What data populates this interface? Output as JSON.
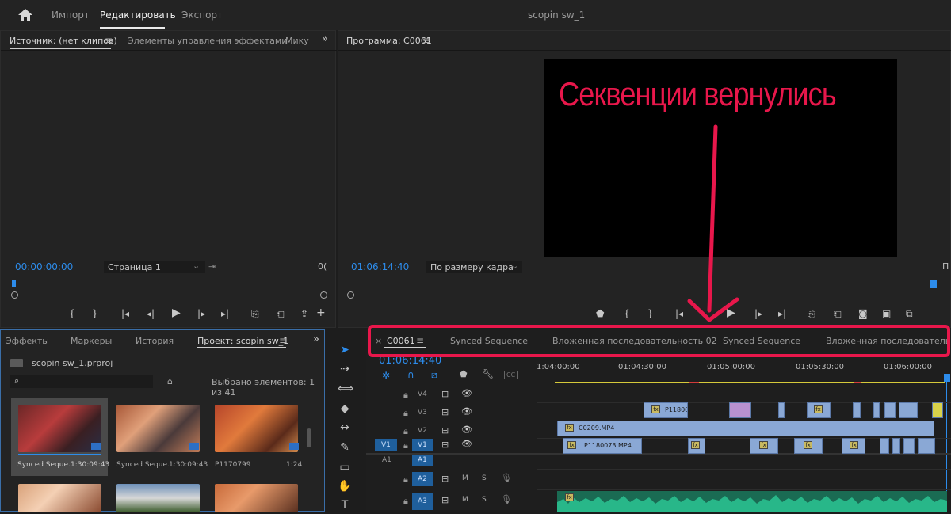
{
  "topbar": {
    "workspaces": [
      "Импорт",
      "Редактировать",
      "Экспорт"
    ],
    "title": "scopin sw_1"
  },
  "source_panel": {
    "tabs": [
      "Источник: (нет клипов)",
      "Элементы управления эффектами",
      "Мику"
    ],
    "timecode": "00:00:00:00",
    "page_select": "Страница 1",
    "right_tc": "0("
  },
  "program_panel": {
    "tab": "Программа: C0061",
    "timecode": "01:06:14:40",
    "fit_select": "По размеру кадра",
    "right_stub": "П",
    "overlay_caption": "Секвенции вернулись"
  },
  "project_panel": {
    "tabs": [
      "Эффекты",
      "Маркеры",
      "История",
      "Проект: scopin sw_1"
    ],
    "project_file": "scopin sw_1.prproj",
    "selection": "Выбрано элементов: 1 из 41",
    "search_placeholder": "",
    "items": [
      {
        "name": "Synced Seque...",
        "duration": "1:30:09:43"
      },
      {
        "name": "Synced Seque...",
        "duration": "1:30:09:43"
      },
      {
        "name": "P1170799",
        "duration": "1:24"
      }
    ]
  },
  "timeline": {
    "tabs": [
      "C0061",
      "Synced Sequence",
      "Вложенная последовательность 02",
      "Synced Sequence",
      "Вложенная последовательность"
    ],
    "timecode": "01:06:14:40",
    "ruler": [
      "1:04:00:00",
      "01:04:30:00",
      "01:05:00:00",
      "01:05:30:00",
      "01:06:00:00"
    ],
    "tracks": {
      "video": [
        "V4",
        "V3",
        "V2",
        "V1"
      ],
      "audio": [
        "A1",
        "A2",
        "A3"
      ],
      "src_v": "V1",
      "src_a": "A1"
    },
    "mute": "M",
    "solo": "S",
    "clips": {
      "v3_label": "P11800",
      "v2_label": "C0209.MP4",
      "v1_label": "P1180073.MP4"
    },
    "cc": "CC"
  },
  "colors": {
    "accent_blue": "#2d8ceb",
    "annotation_red": "#e8174b",
    "clip_blue": "#8aa8d5",
    "audio_green": "#1ea97c"
  }
}
